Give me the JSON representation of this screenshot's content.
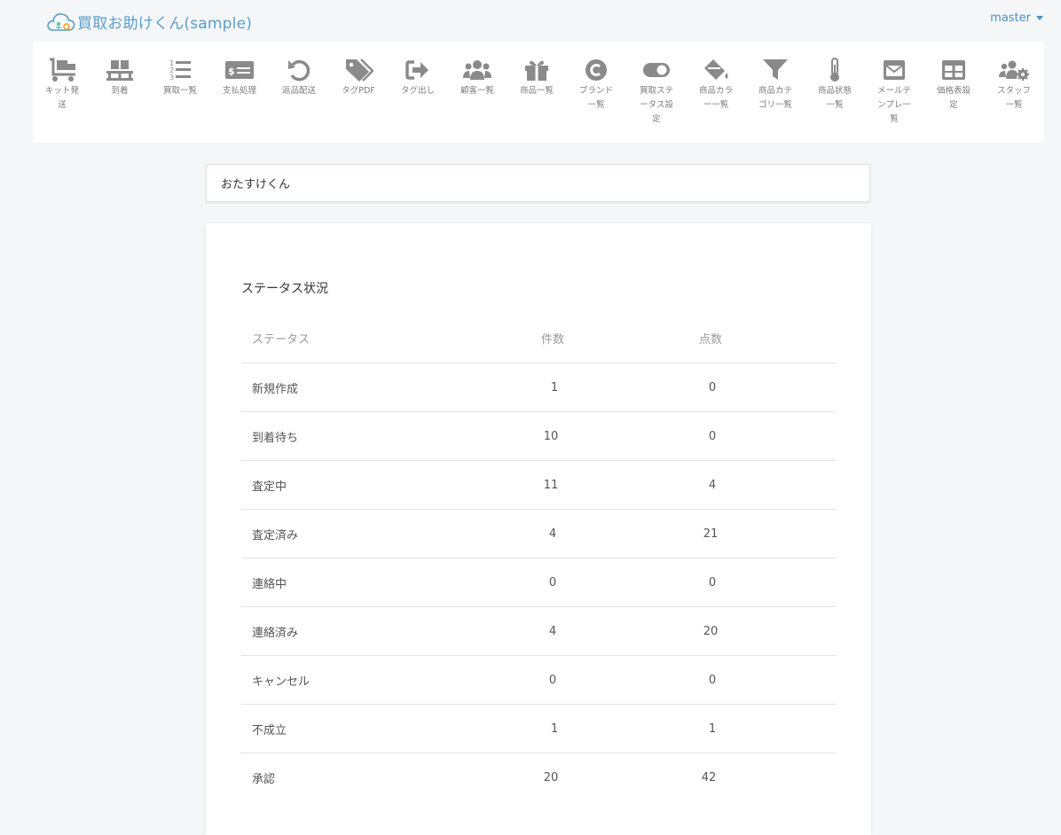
{
  "app": {
    "title": "買取お助けくん(sample)",
    "user": "master",
    "accent_color": "#5b9ec9"
  },
  "nav": {
    "items": [
      {
        "label": "キット発送",
        "icon": "dolly-icon"
      },
      {
        "label": "到着",
        "icon": "pallet-icon"
      },
      {
        "label": "買取一覧",
        "icon": "numbered-list-icon"
      },
      {
        "label": "支払処理",
        "icon": "money-check-icon"
      },
      {
        "label": "返品配送",
        "icon": "undo-icon"
      },
      {
        "label": "タグPDF",
        "icon": "tags-icon"
      },
      {
        "label": "タグ出し",
        "icon": "sign-out-icon"
      },
      {
        "label": "顧客一覧",
        "icon": "users-icon"
      },
      {
        "label": "商品一覧",
        "icon": "gift-icon"
      },
      {
        "label": "ブランド一覧",
        "icon": "copyright-icon"
      },
      {
        "label": "買取ステータス設定",
        "icon": "toggle-icon"
      },
      {
        "label": "商品カラー一覧",
        "icon": "fill-drip-icon"
      },
      {
        "label": "商品カテゴリ一覧",
        "icon": "filter-icon"
      },
      {
        "label": "商品状態一覧",
        "icon": "thermometer-icon"
      },
      {
        "label": "メールテンプレ一覧",
        "icon": "envelope-icon"
      },
      {
        "label": "価格表設定",
        "icon": "table-icon"
      },
      {
        "label": "スタッフ一覧",
        "icon": "users-cog-icon"
      }
    ]
  },
  "search": {
    "value": "おたすけくん"
  },
  "status_card": {
    "title": "ステータス状況",
    "headers": [
      "ステータス",
      "件数",
      "点数"
    ],
    "rows": [
      {
        "status": "新規作成",
        "count": "1",
        "points": "0"
      },
      {
        "status": "到着待ち",
        "count": "10",
        "points": "0"
      },
      {
        "status": "査定中",
        "count": "11",
        "points": "4"
      },
      {
        "status": "査定済み",
        "count": "4",
        "points": "21"
      },
      {
        "status": "連絡中",
        "count": "0",
        "points": "0"
      },
      {
        "status": "連絡済み",
        "count": "4",
        "points": "20"
      },
      {
        "status": "キャンセル",
        "count": "0",
        "points": "0"
      },
      {
        "status": "不成立",
        "count": "1",
        "points": "1"
      },
      {
        "status": "承認",
        "count": "20",
        "points": "42"
      }
    ]
  }
}
